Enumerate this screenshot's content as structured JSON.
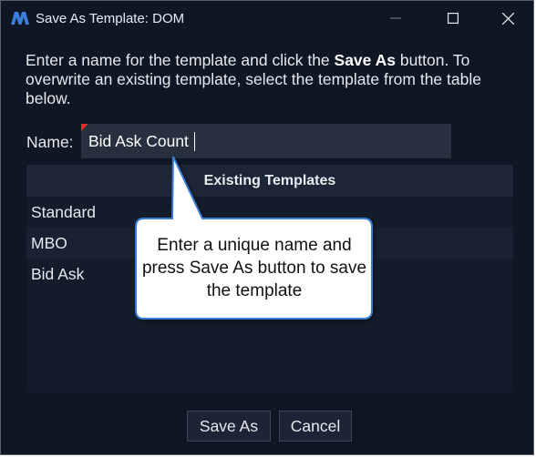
{
  "window": {
    "title": "Save As Template: DOM"
  },
  "instructions": {
    "part1": "Enter a name for the template and click the ",
    "bold": "Save As",
    "part2": " button.  To overwrite an existing template, select the template from the table below."
  },
  "name_field": {
    "label": "Name:",
    "value": "Bid Ask Count"
  },
  "table": {
    "header": "Existing Templates",
    "rows": [
      "Standard",
      "MBO",
      "Bid Ask"
    ]
  },
  "buttons": {
    "save_as": "Save As",
    "cancel": "Cancel"
  },
  "callout": {
    "text": "Enter a unique name and press Save As button to save the template"
  },
  "colors": {
    "background": "#0f1725",
    "input": "#26303f",
    "table_header": "#1c2636",
    "accent_corner": "#e0302c",
    "logo": "#3b7ddd"
  }
}
